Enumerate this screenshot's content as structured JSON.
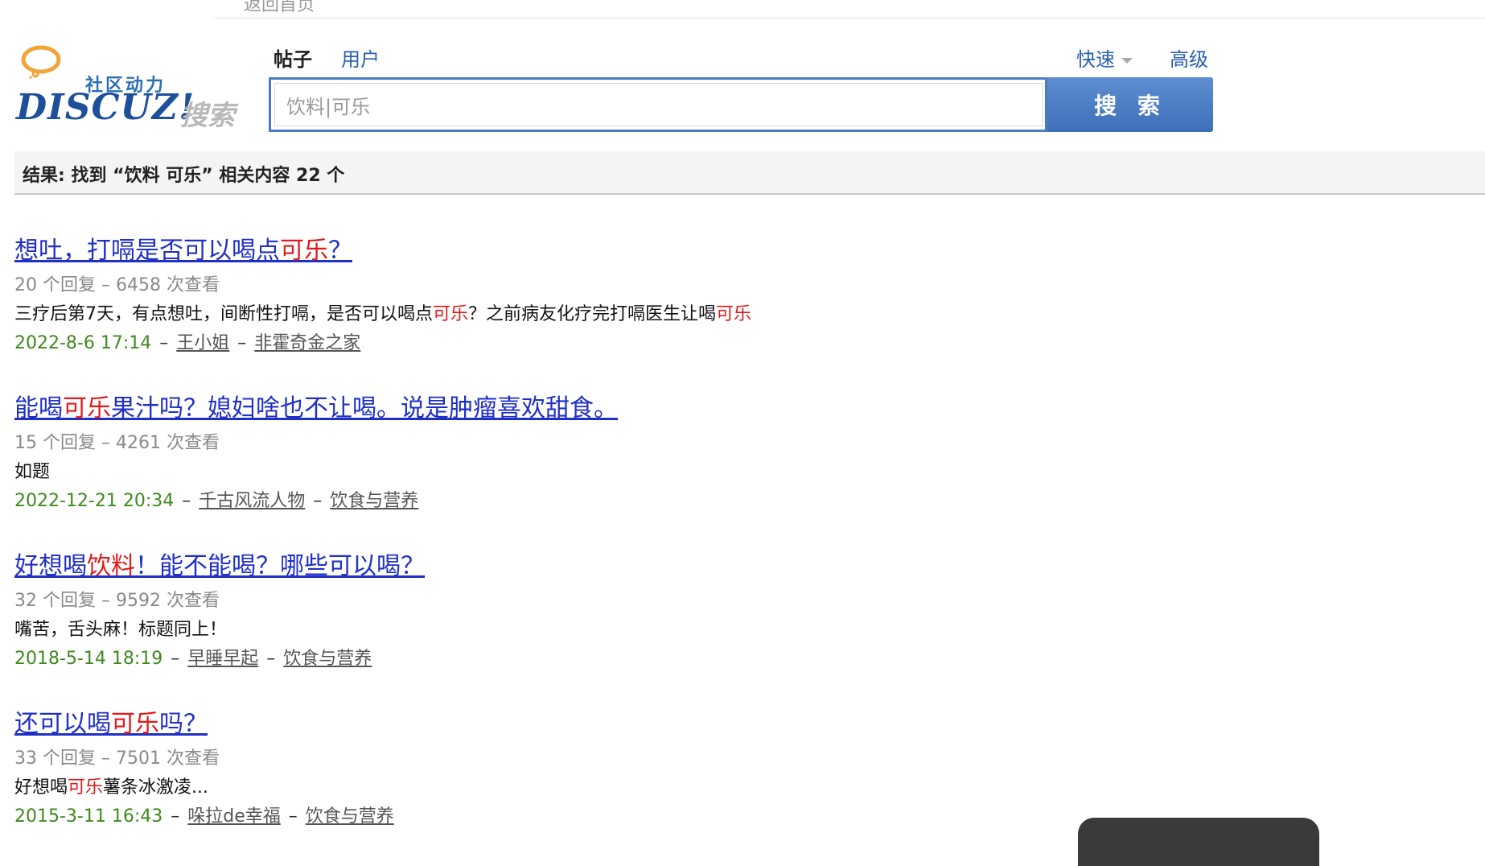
{
  "top_nav": {
    "back_link": "返回首页"
  },
  "logo": {
    "slogan": "社区动力",
    "brand": "DISCUZ!",
    "search_word": "搜索"
  },
  "search": {
    "tabs": [
      "帖子",
      "用户"
    ],
    "mode_quick": "快速",
    "mode_advanced": "高级",
    "query": "饮料|可乐",
    "button_label": "搜 索"
  },
  "result_summary": "结果: 找到 “饮料 可乐” 相关内容 22 个",
  "results": [
    {
      "title_before": "想吐，打嗝是否可以喝点",
      "title_hl": "可乐",
      "title_after": "？",
      "meta": "20 个回复 – 6458 次查看",
      "snippet_before": "三疗后第7天，有点想吐，间断性打嗝，是否可以喝点",
      "snippet_hl1": "可乐",
      "snippet_mid": "？之前病友化疗完打嗝医生让喝",
      "snippet_hl2": "可乐",
      "date": "2022-8-6 17:14",
      "author": "王小姐",
      "forum": "非霍奇金之家"
    },
    {
      "title_before": "能喝",
      "title_hl": "可乐",
      "title_after": "果汁吗？媳妇啥也不让喝。说是肿瘤喜欢甜食。",
      "meta": "15 个回复 – 4261 次查看",
      "snippet_before": "如题",
      "snippet_hl1": "",
      "snippet_mid": "",
      "snippet_hl2": "",
      "date": "2022-12-21 20:34",
      "author": "千古风流人物",
      "forum": "饮食与营养"
    },
    {
      "title_before": "好想喝",
      "title_hl": "饮料",
      "title_after": "！能不能喝？哪些可以喝？",
      "meta": "32 个回复 – 9592 次查看",
      "snippet_before": "嘴苦，舌头麻！标题同上！",
      "snippet_hl1": "",
      "snippet_mid": "",
      "snippet_hl2": "",
      "date": "2018-5-14 18:19",
      "author": "早睡早起",
      "forum": "饮食与营养"
    },
    {
      "title_before": "还可以喝",
      "title_hl": "可乐",
      "title_after": "吗？",
      "meta": "33 个回复 – 7501 次查看",
      "snippet_before": "好想喝",
      "snippet_hl1": "可乐",
      "snippet_mid": "薯条冰激凌...",
      "snippet_hl2": "",
      "date": "2015-3-11 16:43",
      "author": "哚拉de幸福",
      "forum": "饮食与营养"
    }
  ],
  "colors": {
    "link_blue": "#1f2fc7",
    "highlight_red": "#e41919",
    "date_green": "#3e8a1f",
    "button_blue": "#4b7cc3"
  }
}
